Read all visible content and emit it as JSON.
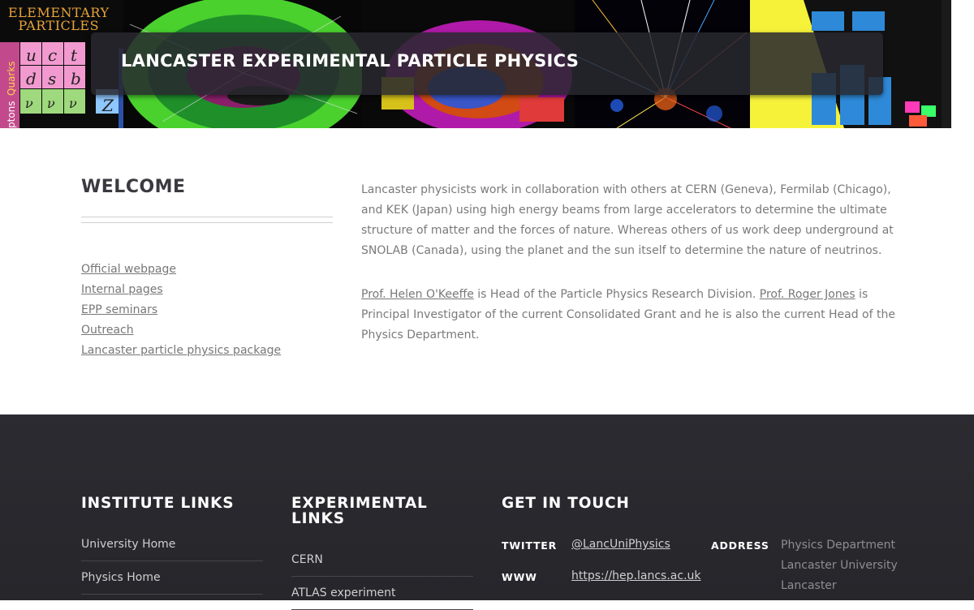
{
  "banner": {
    "title": "LANCASTER EXPERIMENTAL PARTICLE PHYSICS",
    "logo_line1": "ELEMENTARY",
    "logo_line2": "PARTICLES",
    "grid_letters": [
      "u",
      "c",
      "t",
      "d",
      "s",
      "b",
      "ν",
      "ν",
      "ν"
    ],
    "side_labels": [
      "Quarks",
      "ptons"
    ]
  },
  "main": {
    "welcome_title": "WELCOME",
    "side_links": [
      "Official webpage",
      "Internal pages",
      "EPP seminars",
      "Outreach",
      "Lancaster particle physics package"
    ],
    "intro_paragraph": "Lancaster physicists work in collaboration with others at CERN (Geneva), Fermilab (Chicago), and KEK (Japan) using high energy beams from large accelerators to determine the ultimate structure of matter and the forces of nature. Whereas others of us work deep underground at SNOLAB (Canada), using the planet and the sun itself to determine the nature of neutrinos.",
    "heads": {
      "person1_link": "Prof. Helen O'Keeffe",
      "person1_text": " is Head of the Particle Physics Research Division. ",
      "person2_link": "Prof. Roger Jones",
      "person2_text": " is Principal Investigator of the current Consolidated Grant and he is also the current Head of the Physics Department."
    }
  },
  "footer": {
    "institute_title": "INSTITUTE LINKS",
    "institute_links": [
      "University Home",
      "Physics Home"
    ],
    "experimental_title": "EXPERIMENTAL LINKS",
    "experimental_links": [
      "CERN",
      "ATLAS experiment"
    ],
    "contact_title": "GET IN TOUCH",
    "twitter_label": "TWITTER",
    "twitter_value": "@LancUniPhysics",
    "www_label": "WWW",
    "www_value": "https://hep.lancs.ac.uk",
    "address_label": "ADDRESS",
    "address_lines": [
      "Physics Department",
      "Lancaster University",
      "Lancaster"
    ]
  }
}
